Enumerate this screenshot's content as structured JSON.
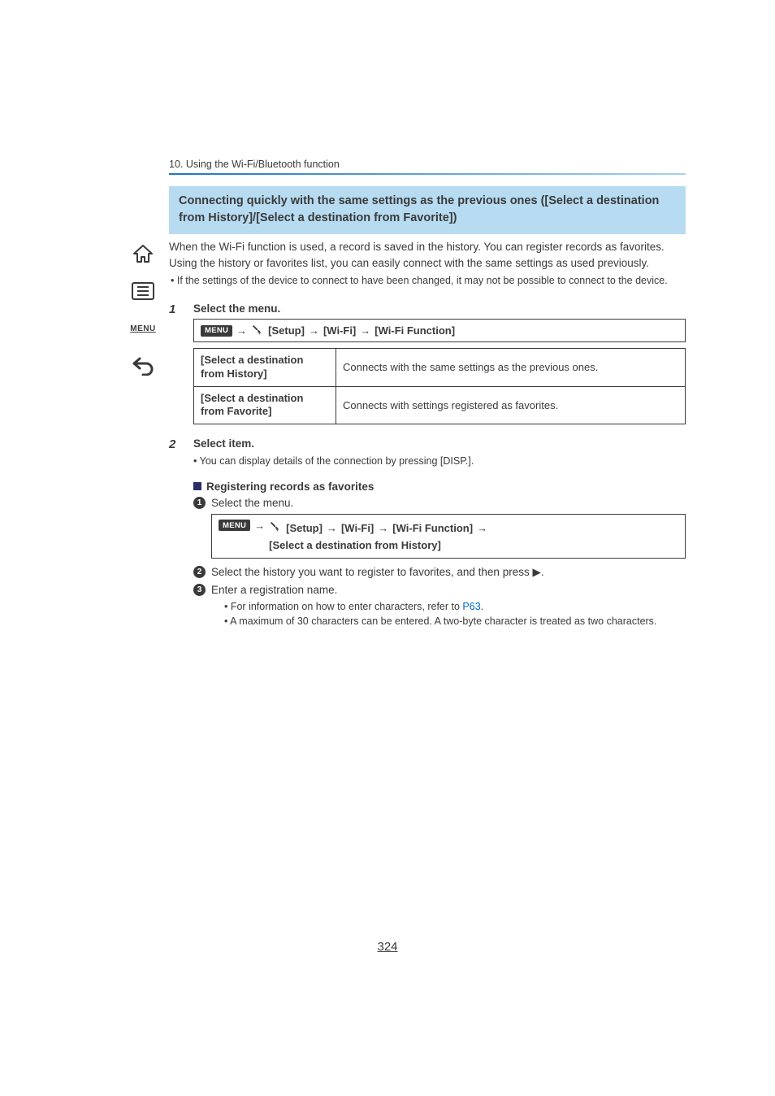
{
  "breadcrumb": "10. Using the Wi-Fi/Bluetooth function",
  "section_title": "Connecting quickly with the same settings as the previous ones ([Select a destination from History]/[Select a destination from Favorite])",
  "intro": "When the Wi-Fi function is used, a record is saved in the history. You can register records as favorites. Using the history or favorites list, you can easily connect with the same settings as used previously.",
  "bullet_note": "• If the settings of the device to connect to have been changed, it may not be possible to connect to the device.",
  "menu_chip": "MENU",
  "sidebar_menu_label": "MENU",
  "step1": {
    "num": "1",
    "title": "Select the menu.",
    "path": {
      "arrow": "→",
      "setup": "[Setup]",
      "wifi": "[Wi-Fi]",
      "func": "[Wi-Fi Function]"
    },
    "table": [
      {
        "label": "[Select a destination from History]",
        "desc": "Connects with the same settings as the previous ones."
      },
      {
        "label": "[Select a destination from Favorite]",
        "desc": "Connects with settings registered as favorites."
      }
    ]
  },
  "step2": {
    "num": "2",
    "title": "Select item.",
    "sub": "• You can display details of the connection by pressing [DISP.]."
  },
  "reg_heading": "Registering records as favorites",
  "reg_items": {
    "i1": "Select the menu.",
    "path2": {
      "arrow": "→",
      "setup": "[Setup]",
      "wifi": "[Wi-Fi]",
      "func": "[Wi-Fi Function]",
      "trailing_arrow": "→",
      "line2": "[Select a destination from History]"
    },
    "i2_pre": "Select the history you want to register to favorites, and then press ",
    "i2_glyph": "▶",
    "i2_post": ".",
    "i3": "Enter a registration name.",
    "i3_sub1_pre": "• For information on how to enter characters, refer to ",
    "i3_sub1_link": "P63",
    "i3_sub1_post": ".",
    "i3_sub2": "• A maximum of 30 characters can be entered. A two-byte character is treated as two characters."
  },
  "page_number": "324"
}
